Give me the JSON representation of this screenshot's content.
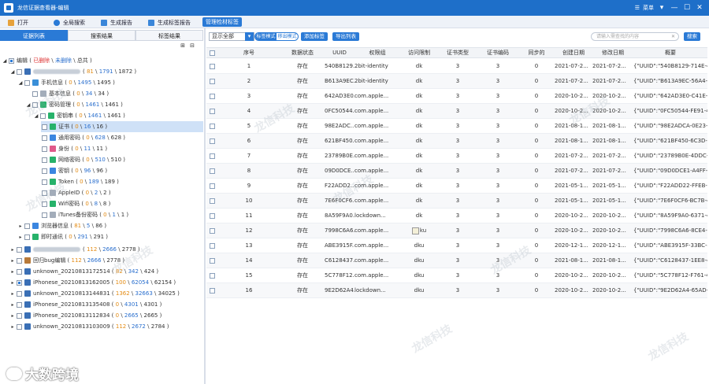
{
  "titlebar": {
    "title": "龙信证据查看器-编辑",
    "menu_label": "菜单",
    "controls": [
      "▾",
      "—",
      "☐",
      "✕"
    ]
  },
  "toolbar": {
    "open": "打开",
    "global_search": "全局搜索",
    "gen_report": "生成报告",
    "gen_tag_report": "生成标签报告",
    "manage_tags": "管理检材标签"
  },
  "left_tabs": [
    "证据列表",
    "搜索结果",
    "标签结果"
  ],
  "tree": {
    "root": {
      "label": "编辑",
      "del": "已删除",
      "undel": "未删除",
      "total": "总共"
    },
    "device_counts": {
      "a": "81",
      "b": "1791",
      "c": "1872"
    },
    "phone_info": {
      "label": "手机信息",
      "a": "0",
      "b": "1495",
      "c": "1495"
    },
    "basic_info": {
      "label": "基本信息",
      "a": "0",
      "b": "34",
      "c": "34"
    },
    "pwd_mgmt": {
      "label": "密码管理",
      "a": "0",
      "b": "1461",
      "c": "1461"
    },
    "keychain": {
      "label": "密钥串",
      "a": "0",
      "b": "1461",
      "c": "1461"
    },
    "keychain_items": [
      {
        "label": "证书",
        "a": "0",
        "b": "16",
        "c": "16",
        "icon": "green"
      },
      {
        "label": "通用密码",
        "a": "0",
        "b": "628",
        "c": "628",
        "icon": "blue"
      },
      {
        "label": "身份",
        "a": "0",
        "b": "11",
        "c": "11",
        "icon": "pink"
      },
      {
        "label": "网络密码",
        "a": "0",
        "b": "510",
        "c": "510",
        "icon": "green"
      },
      {
        "label": "密钥",
        "a": "0",
        "b": "96",
        "c": "96",
        "icon": "blue"
      },
      {
        "label": "Token",
        "a": "0",
        "b": "189",
        "c": "189",
        "icon": "green"
      },
      {
        "label": "AppleID",
        "a": "0",
        "b": "2",
        "c": "2",
        "icon": "gray"
      },
      {
        "label": "Wifi密码",
        "a": "0",
        "b": "8",
        "c": "8",
        "icon": "green"
      },
      {
        "label": "iTunes备份密码",
        "a": "0",
        "b": "1",
        "c": "1",
        "icon": "gray"
      }
    ],
    "browser": {
      "label": "浏览器信息",
      "a": "81",
      "b": "5",
      "c": "86"
    },
    "im": {
      "label": "即时通讯",
      "a": "0",
      "b": "291",
      "c": "291"
    },
    "devices": [
      {
        "label": "",
        "a": "112",
        "b": "2666",
        "c": "2778",
        "blur": true
      },
      {
        "label": "回归bug编辑",
        "a": "112",
        "b": "2666",
        "c": "2778",
        "blur": false
      },
      {
        "label": "unknown_20210813172514",
        "a": "82",
        "b": "342",
        "c": "424",
        "blur": false
      },
      {
        "label": "iPhonese_20210813162005",
        "a": "100",
        "b": "62054",
        "c": "62154",
        "blur": false
      },
      {
        "label": "unknown_20210813144831",
        "a": "1362",
        "b": "32663",
        "c": "34025",
        "blur": false
      },
      {
        "label": "iPhonese_20210813135408",
        "a": "0",
        "b": "4301",
        "c": "4301",
        "blur": false
      },
      {
        "label": "iPhonese_20210813112834",
        "a": "0",
        "b": "2665",
        "c": "2665",
        "blur": false
      },
      {
        "label": "unknown_20210813103009",
        "a": "112",
        "b": "2672",
        "c": "2784",
        "blur": false
      }
    ]
  },
  "right_bar": {
    "display_select": "显示全部",
    "toggle_on": "标签模式",
    "toggle_off": "移出模式",
    "add_tag": "添加标签",
    "export_list": "导出列表",
    "search_placeholder": "请输入需查找的内容",
    "search_clear": "✕",
    "search_button": "搜索"
  },
  "grid": {
    "headers": [
      "",
      "序号",
      "数据状态",
      "UUID",
      "权限组",
      "访问限制",
      "证书类型",
      "证书编码",
      "同步的",
      "创建日期",
      "修改日期",
      "概要"
    ],
    "rows": [
      [
        "1",
        "存在",
        "540B8129...",
        "2bit-identity",
        "dk",
        "3",
        "3",
        "0",
        "2021-07-2...",
        "2021-07-2...",
        "{\"UUID\":\"540B8129-714E-4608-..."
      ],
      [
        "2",
        "存在",
        "B613A9EC...",
        "2bit-identity",
        "dk",
        "3",
        "3",
        "0",
        "2021-07-2...",
        "2021-07-2...",
        "{\"UUID\":\"B613A9EC-56A4-41CC..."
      ],
      [
        "3",
        "存在",
        "642AD3E0...",
        "com.apple...",
        "dk",
        "3",
        "3",
        "0",
        "2020-10-2...",
        "2020-10-2...",
        "{\"UUID\":\"642AD3E0-C41E-419A..."
      ],
      [
        "4",
        "存在",
        "0FC50544...",
        "com.apple...",
        "dk",
        "3",
        "3",
        "0",
        "2020-10-2...",
        "2020-10-2...",
        "{\"UUID\":\"0FC50544-FE91-491A-..."
      ],
      [
        "5",
        "存在",
        "98E2ADC...",
        "com.apple...",
        "dk",
        "3",
        "3",
        "0",
        "2021-08-1...",
        "2021-08-1...",
        "{\"UUID\":\"98E2ADCA-0E23-4C83..."
      ],
      [
        "6",
        "存在",
        "621BF450...",
        "com.apple...",
        "dk",
        "3",
        "3",
        "0",
        "2021-08-1...",
        "2021-08-1...",
        "{\"UUID\":\"621BF450-6C3D-4DA9..."
      ],
      [
        "7",
        "存在",
        "23789B0E...",
        "com.apple...",
        "dk",
        "3",
        "3",
        "0",
        "2021-07-2...",
        "2021-07-2...",
        "{\"UUID\":\"23789B0E-4DDC-45E2..."
      ],
      [
        "8",
        "存在",
        "09D0DCE...",
        "com.apple...",
        "dk",
        "3",
        "3",
        "0",
        "2021-07-2...",
        "2021-07-2...",
        "{\"UUID\":\"09D0DCE1-A4FF-423C..."
      ],
      [
        "9",
        "存在",
        "F22ADD2...",
        "com.apple...",
        "dk",
        "3",
        "3",
        "0",
        "2021-05-1...",
        "2021-05-1...",
        "{\"UUID\":\"F22ADD22-FFEB-4115..."
      ],
      [
        "10",
        "存在",
        "7E6F0CF6...",
        "com.apple...",
        "dk",
        "3",
        "3",
        "0",
        "2021-05-1...",
        "2021-05-1...",
        "{\"UUID\":\"7E6F0CF6-BC7B-496F-..."
      ],
      [
        "11",
        "存在",
        "8A59F9A0...",
        "lockdown...",
        "dk",
        "3",
        "3",
        "0",
        "2020-10-2...",
        "2020-10-2...",
        "{\"UUID\":\"8A59F9A0-6371-4276-..."
      ],
      [
        "12",
        "存在",
        "7998C6A6...",
        "com.apple...",
        "ku",
        "3",
        "3",
        "0",
        "2020-10-2...",
        "2020-10-2...",
        "{\"UUID\":\"7998C6A6-8CE4-4D9A..."
      ],
      [
        "13",
        "存在",
        "ABE3915F...",
        "com.apple...",
        "dku",
        "3",
        "3",
        "0",
        "2020-12-1...",
        "2020-12-1...",
        "{\"UUID\":\"ABE3915F-33BC-4F4D..."
      ],
      [
        "14",
        "存在",
        "C6128437...",
        "com.apple...",
        "dku",
        "3",
        "3",
        "0",
        "2021-08-1...",
        "2021-08-1...",
        "{\"UUID\":\"C6128437-1EE8-45A9-..."
      ],
      [
        "15",
        "存在",
        "5C778F12...",
        "com.apple...",
        "dku",
        "3",
        "3",
        "0",
        "2020-10-2...",
        "2020-10-2...",
        "{\"UUID\":\"5C778F12-F761-4D6E-..."
      ],
      [
        "16",
        "存在",
        "9E2D62A4...",
        "lockdown...",
        "dku",
        "3",
        "3",
        "0",
        "2020-10-2...",
        "2020-10-2...",
        "{\"UUID\":\"9E2D62A4-65AD-4946..."
      ]
    ]
  },
  "watermark": "龙信科技",
  "brand": "大数跨境"
}
